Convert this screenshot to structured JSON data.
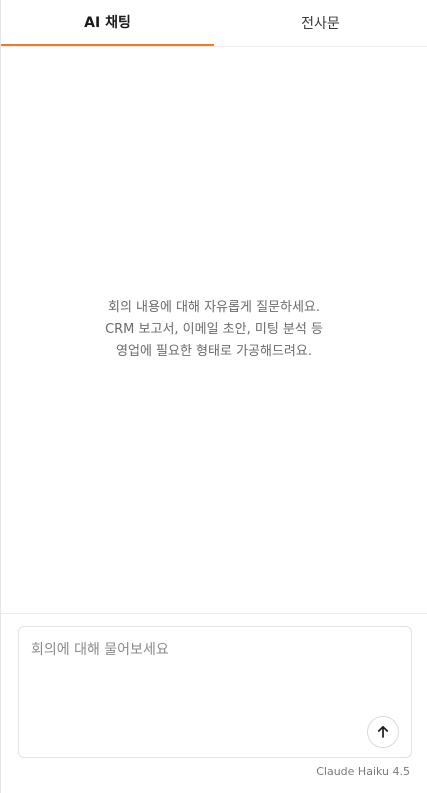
{
  "tabs": [
    {
      "label": "AI 채팅",
      "active": true
    },
    {
      "label": "전사문",
      "active": false
    }
  ],
  "empty_state": {
    "lines": [
      "회의 내용에 대해 자유롭게 질문하세요.",
      "CRM 보고서, 이메일 초안, 미팅 분석 등",
      "영업에 필요한 형태로 가공해드려요."
    ]
  },
  "composer": {
    "placeholder": "회의에 대해 물어보세요",
    "value": ""
  },
  "send_button": {
    "icon": "arrow-up-icon"
  },
  "model": {
    "label": "Claude Haiku 4.5"
  },
  "colors": {
    "accent": "#f07a2c",
    "border": "#e3e3e3",
    "muted_text": "#6b6b6b"
  }
}
